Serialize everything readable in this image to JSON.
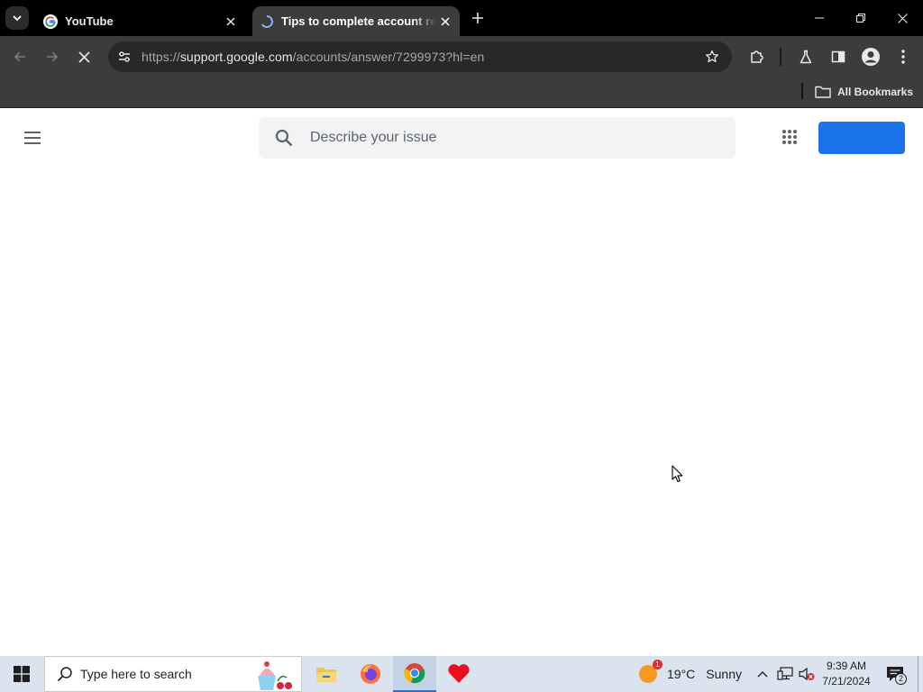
{
  "browser": {
    "tabs": [
      {
        "title": "YouTube",
        "favicon": "google-g-icon",
        "active": false
      },
      {
        "title": "Tips to complete account recovery steps",
        "favicon": "loading-spinner-icon",
        "active": true
      }
    ],
    "url": {
      "scheme": "https://",
      "host": "support.google.com",
      "path": "/accounts/answer/7299973?hl=en"
    },
    "bookmarks": {
      "all_label": "All Bookmarks"
    }
  },
  "page": {
    "search": {
      "placeholder": "Describe your issue",
      "value": ""
    },
    "signin_button_label": "",
    "accent_color": "#1a73e8"
  },
  "taskbar": {
    "search_placeholder": "Type here to search",
    "weather": {
      "temp": "19°C",
      "condition": "Sunny",
      "badge": "1"
    },
    "clock": {
      "time": "9:39 AM",
      "date": "7/21/2024"
    },
    "notifications_count": "2"
  }
}
